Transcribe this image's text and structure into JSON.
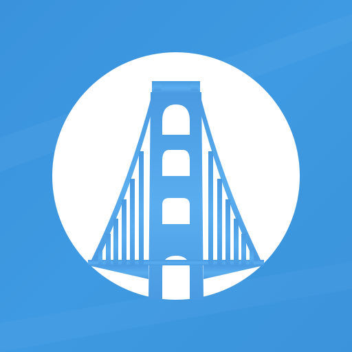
{
  "icon": {
    "name": "bridge-app-icon",
    "symbol": "bridge-icon",
    "colors": {
      "background": "#3a93de",
      "background_light": "#4aa6ec",
      "circle": "#ffffff",
      "bridge": "#4ea0e4"
    }
  }
}
